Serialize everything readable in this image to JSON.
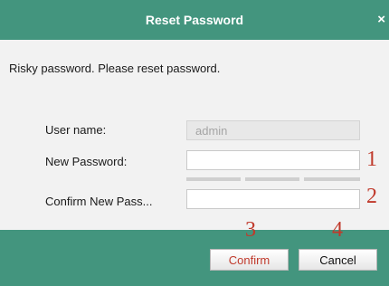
{
  "dialog": {
    "title": "Reset Password",
    "close_glyph": "×",
    "message": "Risky password. Please reset password."
  },
  "form": {
    "username_label": "User name:",
    "username_value": "admin",
    "new_password_label": "New Password:",
    "new_password_value": "",
    "confirm_label": "Confirm New Pass...",
    "confirm_value": ""
  },
  "annotations": {
    "n1": "1",
    "n2": "2",
    "n3": "3",
    "n4": "4"
  },
  "buttons": {
    "confirm": "Confirm",
    "cancel": "Cancel"
  },
  "colors": {
    "titlebar": "#43957e",
    "annotation": "#c0392b"
  }
}
